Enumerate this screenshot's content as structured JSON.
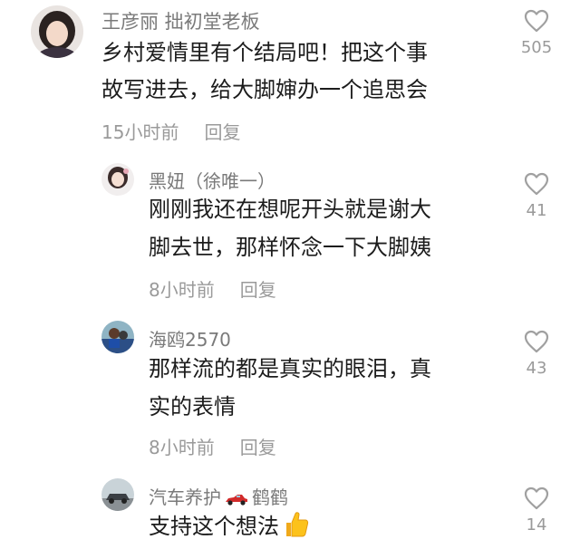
{
  "comments": [
    {
      "username": "王彦丽 拙初堂老板",
      "lines": [
        "乡村爱情里有个结局吧！把这个事",
        "故写进去，给大脚婶办一个追思会"
      ],
      "time": "15小时前",
      "reply_label": "回复",
      "likes": "505"
    },
    {
      "username": "黑妞（徐唯一）",
      "lines": [
        "刚刚我还在想呢开头就是谢大",
        "脚去世，那样怀念一下大脚姨"
      ],
      "time": "8小时前",
      "reply_label": "回复",
      "likes": "41"
    },
    {
      "username": "海鸥2570",
      "lines": [
        "那样流的都是真实的眼泪，真",
        "实的表情"
      ],
      "time": "8小时前",
      "reply_label": "回复",
      "likes": "43"
    },
    {
      "username_part1": "汽车养护",
      "username_part2": "鹤鹤",
      "text": "支持这个想法",
      "likes": "14"
    }
  ],
  "icons": {
    "like": "heart-outline-icon",
    "car_emoji": "race-car-emoji",
    "thumb_emoji": "thumbs-up-emoji"
  },
  "colors": {
    "text": "#1c1c1c",
    "secondary": "#7a7a7a",
    "meta": "#9a9a9a",
    "heart_stroke": "#a0a0a0"
  }
}
